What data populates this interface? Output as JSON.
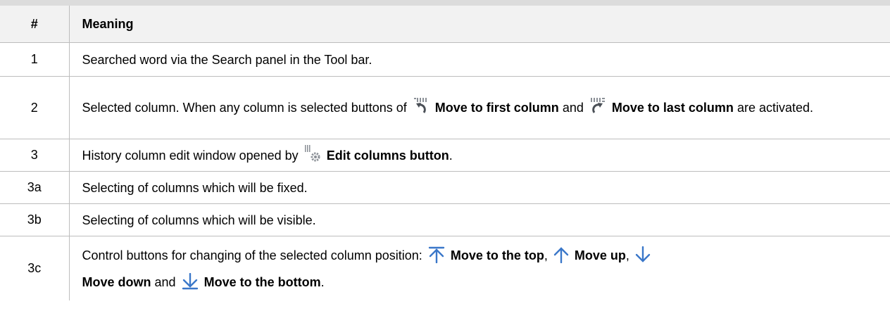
{
  "table": {
    "header": {
      "num": "#",
      "meaning": "Meaning"
    },
    "rows": [
      {
        "num": "1",
        "text": "Searched word via the Search panel in the Tool bar."
      },
      {
        "num": "2",
        "pre": "Selected column. When any column is selected buttons of",
        "b1": "Move to first column",
        "mid": "and",
        "b2": "Move to last column",
        "post": "are activated."
      },
      {
        "num": "3",
        "pre": "History column edit window opened by",
        "b1": "Edit columns button",
        "post": "."
      },
      {
        "num": "3a",
        "text": "Selecting of columns which will be fixed."
      },
      {
        "num": "3b",
        "text": "Selecting of columns which will be visible."
      },
      {
        "num": "3c",
        "pre": "Control buttons for changing of the selected column position:",
        "b1": "Move to the top",
        "sep1": ",",
        "b2": "Move up",
        "sep2": ",",
        "b3": "Move down",
        "mid": "and",
        "b4": "Move to the bottom",
        "post": "."
      }
    ]
  },
  "icons": {
    "move_first": "move-to-first-column-icon",
    "move_last": "move-to-last-column-icon",
    "edit_columns": "edit-columns-icon",
    "move_top": "move-to-top-icon",
    "move_up": "move-up-icon",
    "move_down": "move-down-icon",
    "move_bottom": "move-to-bottom-icon"
  },
  "colors": {
    "arrow_blue": "#3a77c9",
    "icon_grey": "#8a8f96"
  }
}
